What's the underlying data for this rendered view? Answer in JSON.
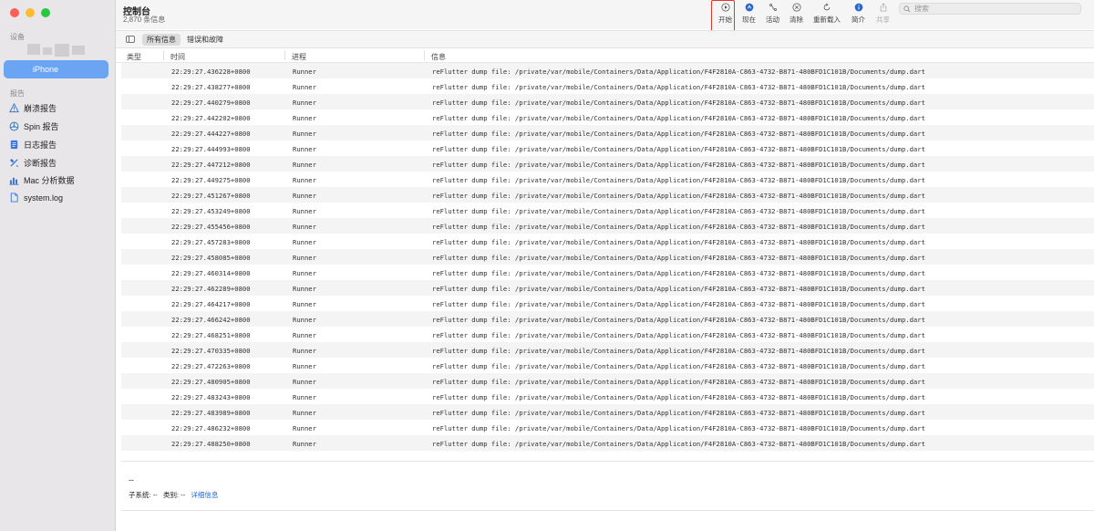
{
  "sidebar": {
    "devices_label": "设备",
    "device_selected": "iPhone",
    "reports_label": "报告",
    "items": [
      {
        "label": "崩溃报告",
        "icon": "warning-icon"
      },
      {
        "label": "Spin 报告",
        "icon": "spin-icon"
      },
      {
        "label": "日志报告",
        "icon": "document-icon"
      },
      {
        "label": "诊断报告",
        "icon": "tools-icon"
      },
      {
        "label": "Mac 分析数据",
        "icon": "chart-icon"
      },
      {
        "label": "system.log",
        "icon": "file-icon"
      }
    ]
  },
  "toolbar": {
    "title": "控制台",
    "subtitle": "2,870 条信息",
    "buttons": [
      {
        "label": "开始",
        "icon": "play-icon"
      },
      {
        "label": "现在",
        "icon": "now-icon"
      },
      {
        "label": "活动",
        "icon": "activity-icon"
      },
      {
        "label": "清除",
        "icon": "clear-icon"
      },
      {
        "label": "重新载入",
        "icon": "reload-icon"
      },
      {
        "label": "简介",
        "icon": "info-icon"
      },
      {
        "label": "共享",
        "icon": "share-icon"
      }
    ],
    "search_placeholder": "搜索"
  },
  "filter": {
    "tab_all": "所有信息",
    "tab_errors": "错误和故障"
  },
  "columns": {
    "type": "类型",
    "time": "时间",
    "process": "进程",
    "message": "信息"
  },
  "rows": [
    {
      "time": "22:29:27.436228+0800",
      "process": "Runner",
      "message": "reFlutter dump file: /private/var/mobile/Containers/Data/Application/F4F2810A-C863-4732-B871-480BFD1C101B/Documents/dump.dart"
    },
    {
      "time": "22:29:27.438277+0800",
      "process": "Runner",
      "message": "reFlutter dump file: /private/var/mobile/Containers/Data/Application/F4F2810A-C863-4732-B871-480BFD1C101B/Documents/dump.dart"
    },
    {
      "time": "22:29:27.440279+0800",
      "process": "Runner",
      "message": "reFlutter dump file: /private/var/mobile/Containers/Data/Application/F4F2810A-C863-4732-B871-480BFD1C101B/Documents/dump.dart"
    },
    {
      "time": "22:29:27.442202+0800",
      "process": "Runner",
      "message": "reFlutter dump file: /private/var/mobile/Containers/Data/Application/F4F2810A-C863-4732-B871-480BFD1C101B/Documents/dump.dart"
    },
    {
      "time": "22:29:27.444227+0800",
      "process": "Runner",
      "message": "reFlutter dump file: /private/var/mobile/Containers/Data/Application/F4F2810A-C863-4732-B871-480BFD1C101B/Documents/dump.dart"
    },
    {
      "time": "22:29:27.444993+0800",
      "process": "Runner",
      "message": "reFlutter dump file: /private/var/mobile/Containers/Data/Application/F4F2810A-C863-4732-B871-480BFD1C101B/Documents/dump.dart"
    },
    {
      "time": "22:29:27.447212+0800",
      "process": "Runner",
      "message": "reFlutter dump file: /private/var/mobile/Containers/Data/Application/F4F2810A-C863-4732-B871-480BFD1C101B/Documents/dump.dart"
    },
    {
      "time": "22:29:27.449275+0800",
      "process": "Runner",
      "message": "reFlutter dump file: /private/var/mobile/Containers/Data/Application/F4F2810A-C863-4732-B871-480BFD1C101B/Documents/dump.dart"
    },
    {
      "time": "22:29:27.451267+0800",
      "process": "Runner",
      "message": "reFlutter dump file: /private/var/mobile/Containers/Data/Application/F4F2810A-C863-4732-B871-480BFD1C101B/Documents/dump.dart"
    },
    {
      "time": "22:29:27.453249+0800",
      "process": "Runner",
      "message": "reFlutter dump file: /private/var/mobile/Containers/Data/Application/F4F2810A-C863-4732-B871-480BFD1C101B/Documents/dump.dart"
    },
    {
      "time": "22:29:27.455456+0800",
      "process": "Runner",
      "message": "reFlutter dump file: /private/var/mobile/Containers/Data/Application/F4F2810A-C863-4732-B871-480BFD1C101B/Documents/dump.dart"
    },
    {
      "time": "22:29:27.457283+0800",
      "process": "Runner",
      "message": "reFlutter dump file: /private/var/mobile/Containers/Data/Application/F4F2810A-C863-4732-B871-480BFD1C101B/Documents/dump.dart"
    },
    {
      "time": "22:29:27.458085+0800",
      "process": "Runner",
      "message": "reFlutter dump file: /private/var/mobile/Containers/Data/Application/F4F2810A-C863-4732-B871-480BFD1C101B/Documents/dump.dart"
    },
    {
      "time": "22:29:27.460314+0800",
      "process": "Runner",
      "message": "reFlutter dump file: /private/var/mobile/Containers/Data/Application/F4F2810A-C863-4732-B871-480BFD1C101B/Documents/dump.dart"
    },
    {
      "time": "22:29:27.462289+0800",
      "process": "Runner",
      "message": "reFlutter dump file: /private/var/mobile/Containers/Data/Application/F4F2810A-C863-4732-B871-480BFD1C101B/Documents/dump.dart"
    },
    {
      "time": "22:29:27.464217+0800",
      "process": "Runner",
      "message": "reFlutter dump file: /private/var/mobile/Containers/Data/Application/F4F2810A-C863-4732-B871-480BFD1C101B/Documents/dump.dart"
    },
    {
      "time": "22:29:27.466242+0800",
      "process": "Runner",
      "message": "reFlutter dump file: /private/var/mobile/Containers/Data/Application/F4F2810A-C863-4732-B871-480BFD1C101B/Documents/dump.dart"
    },
    {
      "time": "22:29:27.468251+0800",
      "process": "Runner",
      "message": "reFlutter dump file: /private/var/mobile/Containers/Data/Application/F4F2810A-C863-4732-B871-480BFD1C101B/Documents/dump.dart"
    },
    {
      "time": "22:29:27.470335+0800",
      "process": "Runner",
      "message": "reFlutter dump file: /private/var/mobile/Containers/Data/Application/F4F2810A-C863-4732-B871-480BFD1C101B/Documents/dump.dart"
    },
    {
      "time": "22:29:27.472263+0800",
      "process": "Runner",
      "message": "reFlutter dump file: /private/var/mobile/Containers/Data/Application/F4F2810A-C863-4732-B871-480BFD1C101B/Documents/dump.dart"
    },
    {
      "time": "22:29:27.480905+0800",
      "process": "Runner",
      "message": "reFlutter dump file: /private/var/mobile/Containers/Data/Application/F4F2810A-C863-4732-B871-480BFD1C101B/Documents/dump.dart"
    },
    {
      "time": "22:29:27.483243+0800",
      "process": "Runner",
      "message": "reFlutter dump file: /private/var/mobile/Containers/Data/Application/F4F2810A-C863-4732-B871-480BFD1C101B/Documents/dump.dart"
    },
    {
      "time": "22:29:27.483989+0800",
      "process": "Runner",
      "message": "reFlutter dump file: /private/var/mobile/Containers/Data/Application/F4F2810A-C863-4732-B871-480BFD1C101B/Documents/dump.dart"
    },
    {
      "time": "22:29:27.486232+0800",
      "process": "Runner",
      "message": "reFlutter dump file: /private/var/mobile/Containers/Data/Application/F4F2810A-C863-4732-B871-480BFD1C101B/Documents/dump.dart"
    },
    {
      "time": "22:29:27.488250+0800",
      "process": "Runner",
      "message": "reFlutter dump file: /private/var/mobile/Containers/Data/Application/F4F2810A-C863-4732-B871-480BFD1C101B/Documents/dump.dart"
    }
  ],
  "detail": {
    "placeholder": "--",
    "subsystem_label": "子系统:",
    "subsystem_value": "--",
    "category_label": "类别:",
    "category_value": "--",
    "details_link": "详细信息"
  },
  "colors": {
    "selection": "#6aa4f3",
    "highlight": "#e5352b",
    "link": "#1a6ad8"
  }
}
